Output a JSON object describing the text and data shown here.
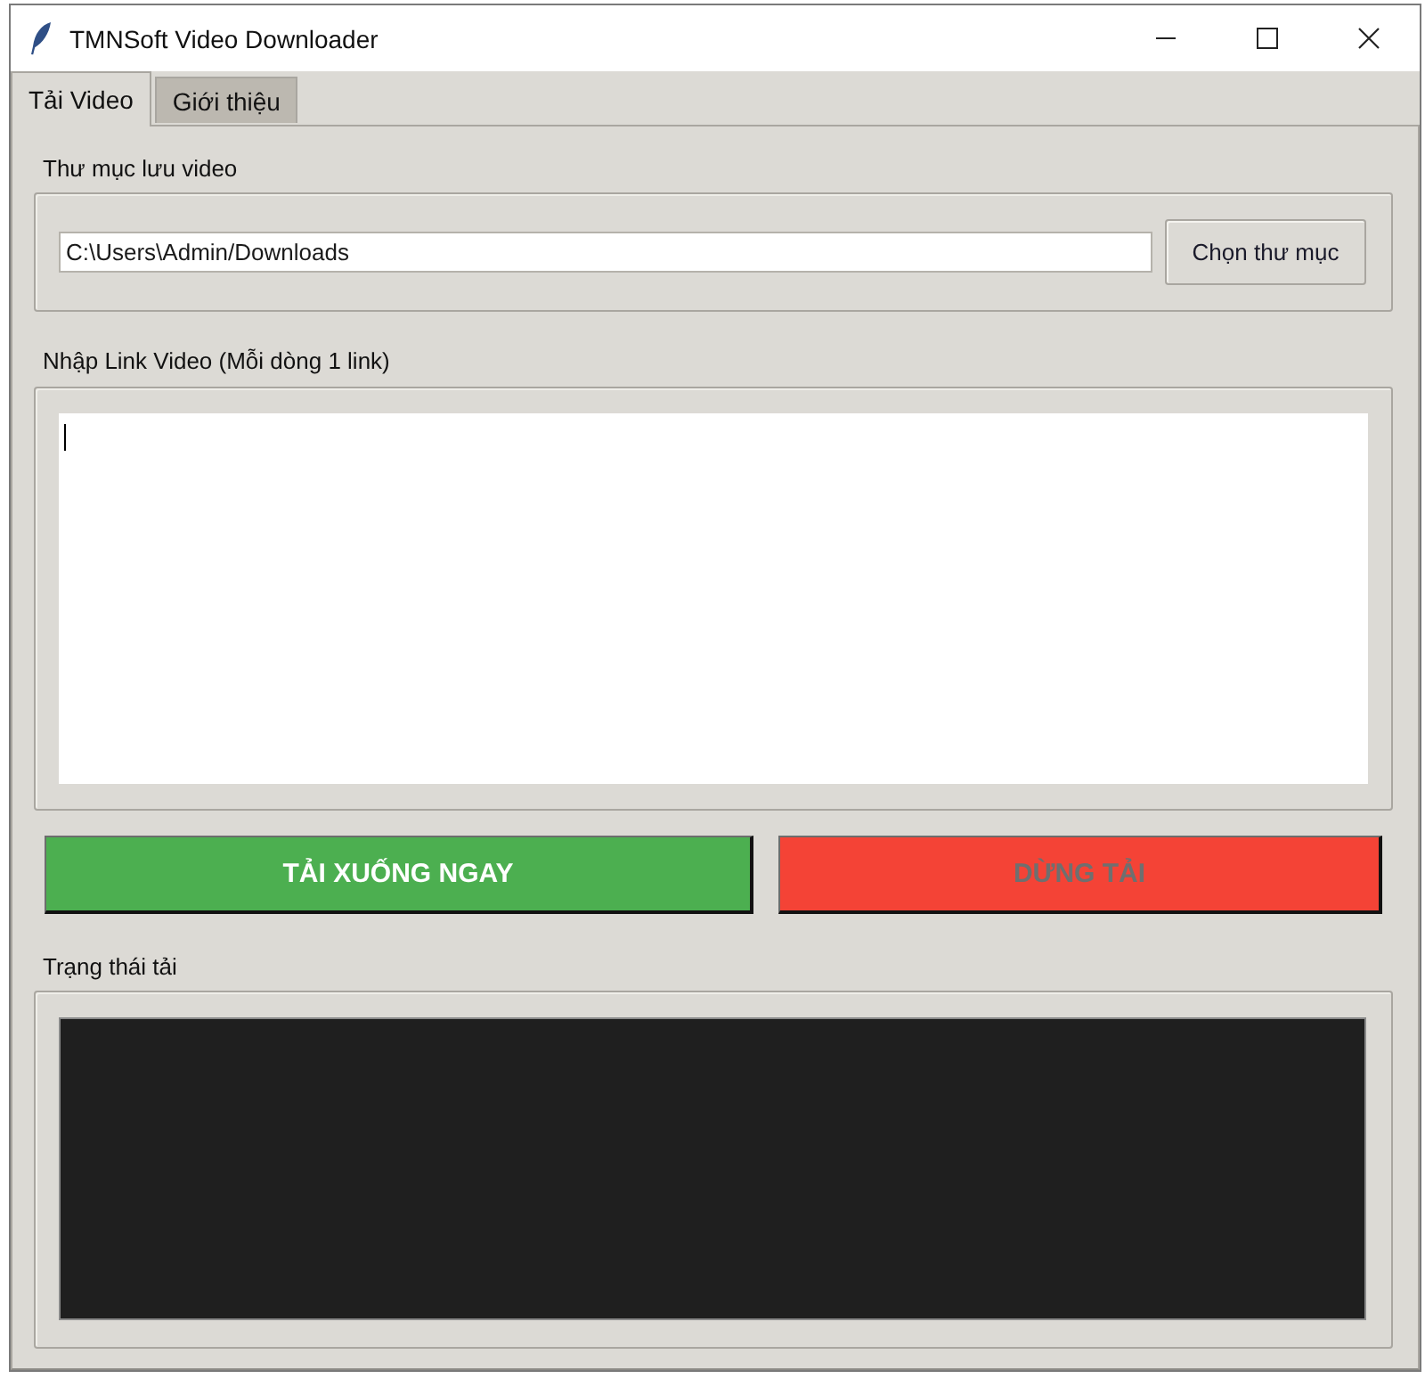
{
  "window": {
    "title": "TMNSoft Video Downloader"
  },
  "tabs": [
    {
      "label": "Tải Video",
      "selected": true
    },
    {
      "label": "Giới thiệu",
      "selected": false
    }
  ],
  "folder_section": {
    "label": "Thư mục lưu video",
    "path_field": {
      "value": "C:\\Users\\Admin/Downloads"
    },
    "browse_button": "Chọn thư mục"
  },
  "links_section": {
    "label": "Nhập Link Video (Mỗi dòng 1 link)",
    "focused": true
  },
  "actions": [
    {
      "kind": "start",
      "label": "TẢI XUỐNG NGAY",
      "disabled": false
    },
    {
      "kind": "stop",
      "label": "DỪNG TẢI",
      "disabled": true
    }
  ],
  "status_section": {
    "label": "Trạng thái tải"
  }
}
